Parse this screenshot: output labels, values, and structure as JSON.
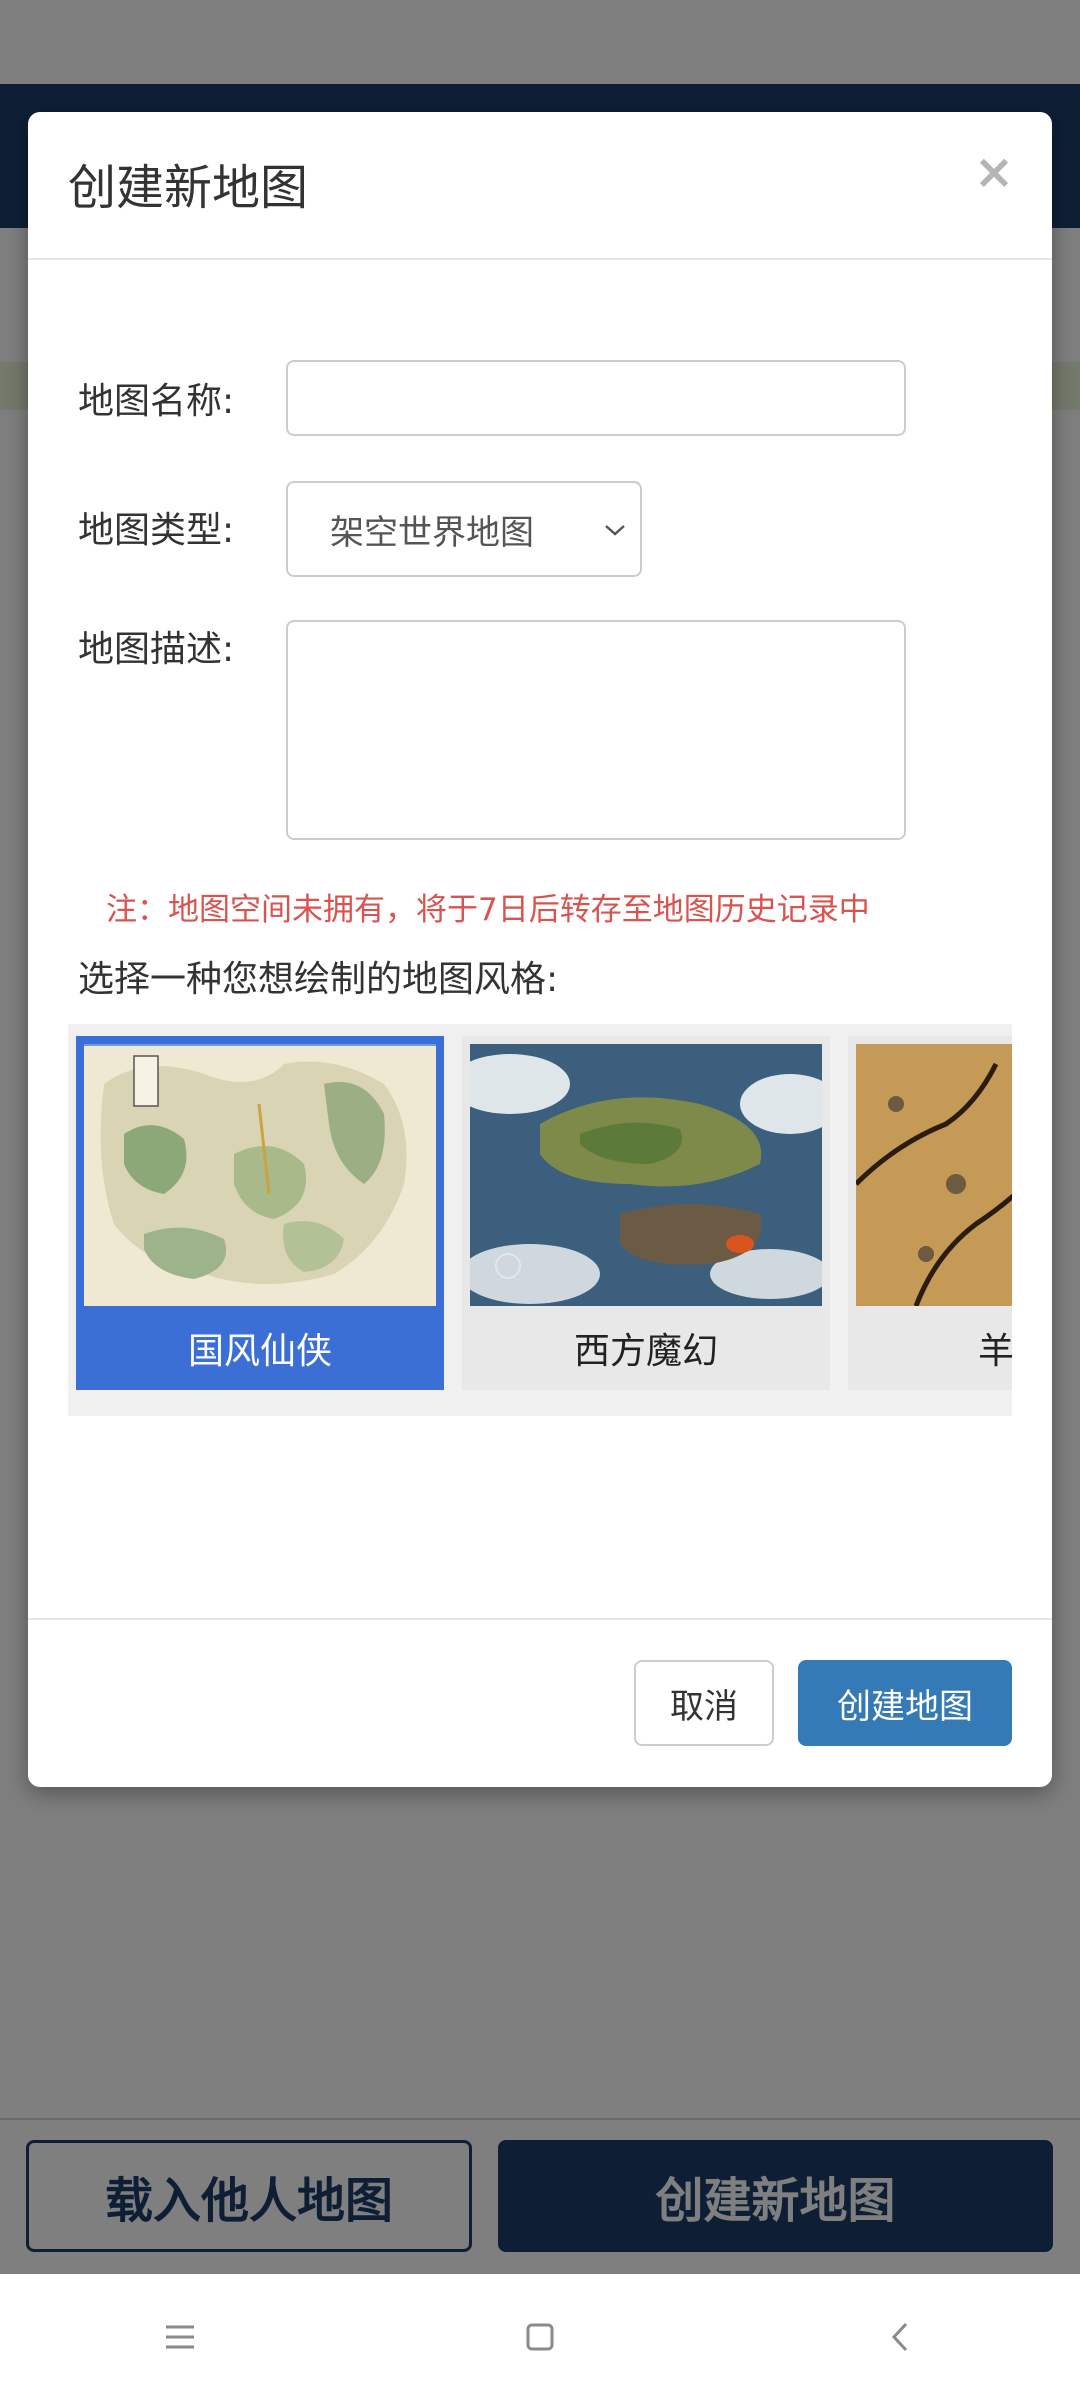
{
  "background": {
    "load_button": "载入他人地图",
    "create_button": "创建新地图"
  },
  "dialog": {
    "title": "创建新地图",
    "close_icon": "×",
    "form": {
      "name_label": "地图名称:",
      "name_value": "",
      "type_label": "地图类型:",
      "type_selected": "架空世界地图",
      "desc_label": "地图描述:",
      "desc_value": ""
    },
    "notice": "注：地图空间未拥有，将于7日后转存至地图历史记录中",
    "style_prompt": "选择一种您想绘制的地图风格:",
    "styles": [
      {
        "label": "国风仙侠",
        "selected": true
      },
      {
        "label": "西方魔幻",
        "selected": false
      },
      {
        "label": "羊",
        "selected": false
      }
    ],
    "cancel_button": "取消",
    "submit_button": "创建地图"
  },
  "nav": {
    "menu_icon": "menu-icon",
    "home_icon": "home-icon",
    "back_icon": "back-icon"
  },
  "colors": {
    "primary": "#337ab7",
    "header": "#1d3f6b",
    "selected_card": "#3b6fd6",
    "notice": "#d9534f"
  }
}
